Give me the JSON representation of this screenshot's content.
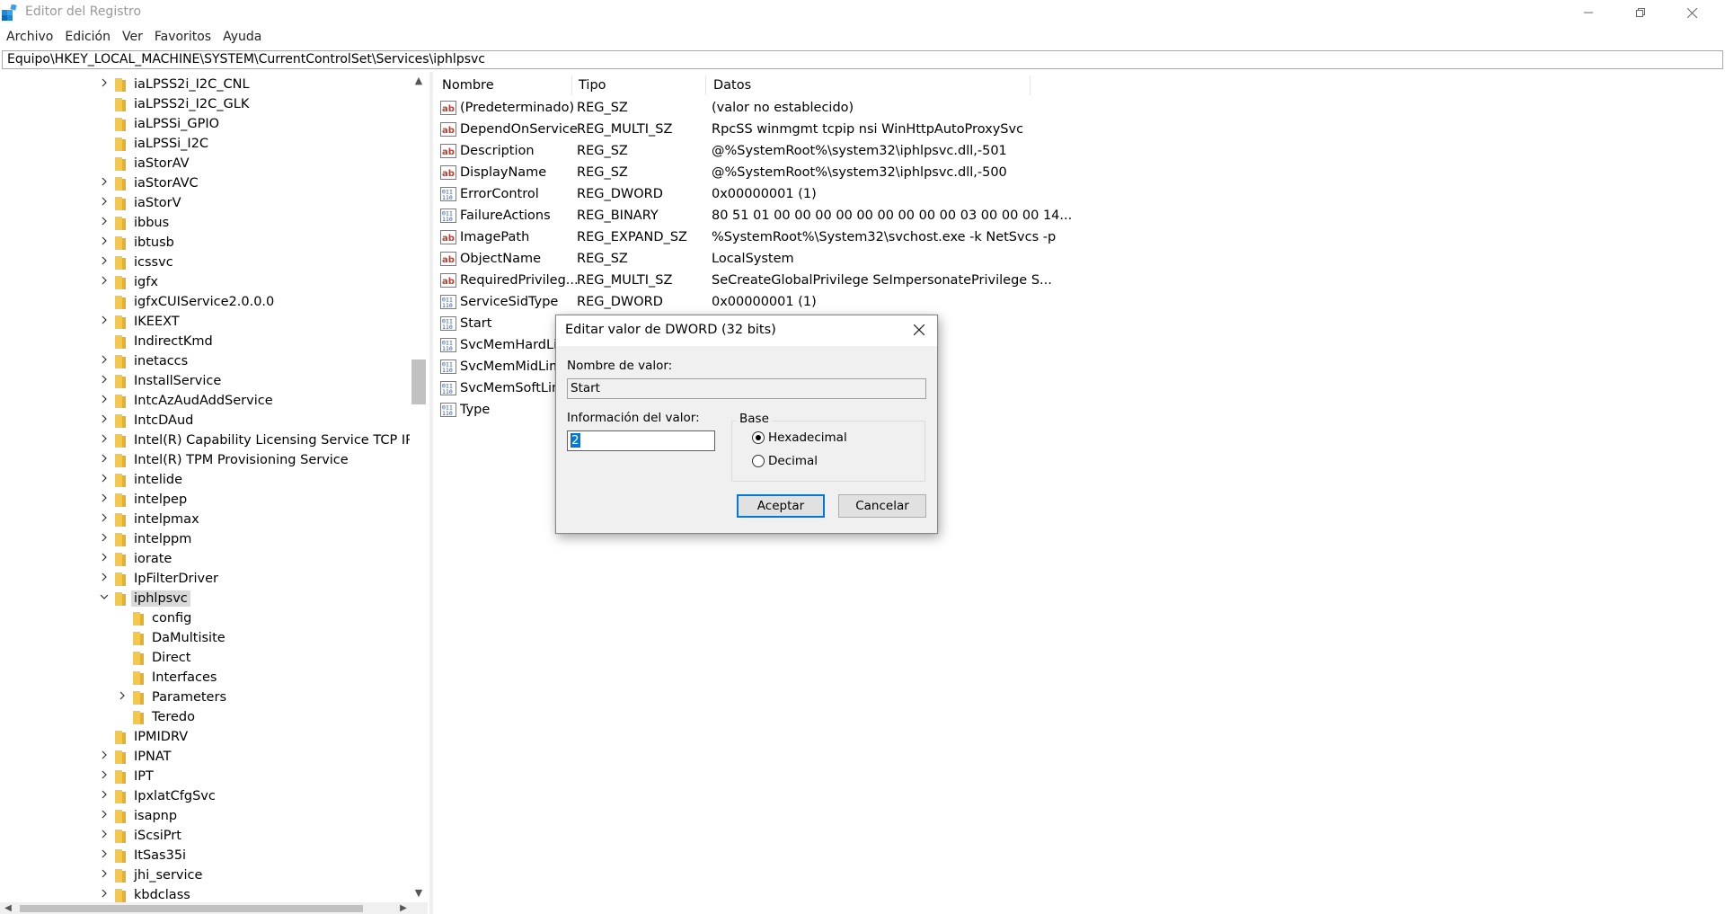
{
  "window": {
    "title": "Editor del Registro"
  },
  "menu": [
    "Archivo",
    "Edición",
    "Ver",
    "Favoritos",
    "Ayuda"
  ],
  "address": "Equipo\\HKEY_LOCAL_MACHINE\\SYSTEM\\CurrentControlSet\\Services\\iphlpsvc",
  "tree": [
    {
      "label": "iaLPSS2i_I2C_CNL",
      "expand": "closed",
      "level": 0
    },
    {
      "label": "iaLPSS2i_I2C_GLK",
      "expand": "none",
      "level": 0
    },
    {
      "label": "iaLPSSi_GPIO",
      "expand": "none",
      "level": 0
    },
    {
      "label": "iaLPSSi_I2C",
      "expand": "none",
      "level": 0
    },
    {
      "label": "iaStorAV",
      "expand": "none",
      "level": 0
    },
    {
      "label": "iaStorAVC",
      "expand": "closed",
      "level": 0
    },
    {
      "label": "iaStorV",
      "expand": "closed",
      "level": 0
    },
    {
      "label": "ibbus",
      "expand": "closed",
      "level": 0
    },
    {
      "label": "ibtusb",
      "expand": "closed",
      "level": 0
    },
    {
      "label": "icssvc",
      "expand": "closed",
      "level": 0
    },
    {
      "label": "igfx",
      "expand": "closed",
      "level": 0
    },
    {
      "label": "igfxCUIService2.0.0.0",
      "expand": "none",
      "level": 0
    },
    {
      "label": "IKEEXT",
      "expand": "closed",
      "level": 0
    },
    {
      "label": "IndirectKmd",
      "expand": "none",
      "level": 0
    },
    {
      "label": "inetaccs",
      "expand": "closed",
      "level": 0
    },
    {
      "label": "InstallService",
      "expand": "closed",
      "level": 0
    },
    {
      "label": "IntcAzAudAddService",
      "expand": "closed",
      "level": 0
    },
    {
      "label": "IntcDAud",
      "expand": "closed",
      "level": 0
    },
    {
      "label": "Intel(R) Capability Licensing Service TCP IP Inte",
      "expand": "closed",
      "level": 0
    },
    {
      "label": "Intel(R) TPM Provisioning Service",
      "expand": "closed",
      "level": 0
    },
    {
      "label": "intelide",
      "expand": "closed",
      "level": 0
    },
    {
      "label": "intelpep",
      "expand": "closed",
      "level": 0
    },
    {
      "label": "intelpmax",
      "expand": "closed",
      "level": 0
    },
    {
      "label": "intelppm",
      "expand": "closed",
      "level": 0
    },
    {
      "label": "iorate",
      "expand": "closed",
      "level": 0
    },
    {
      "label": "IpFilterDriver",
      "expand": "closed",
      "level": 0
    },
    {
      "label": "iphlpsvc",
      "expand": "open",
      "level": 0,
      "selected": true
    },
    {
      "label": "config",
      "expand": "none",
      "level": 1
    },
    {
      "label": "DaMultisite",
      "expand": "none",
      "level": 1
    },
    {
      "label": "Direct",
      "expand": "none",
      "level": 1
    },
    {
      "label": "Interfaces",
      "expand": "none",
      "level": 1
    },
    {
      "label": "Parameters",
      "expand": "closed",
      "level": 1
    },
    {
      "label": "Teredo",
      "expand": "none",
      "level": 1
    },
    {
      "label": "IPMIDRV",
      "expand": "none",
      "level": 0
    },
    {
      "label": "IPNAT",
      "expand": "closed",
      "level": 0
    },
    {
      "label": "IPT",
      "expand": "closed",
      "level": 0
    },
    {
      "label": "IpxlatCfgSvc",
      "expand": "closed",
      "level": 0
    },
    {
      "label": "isapnp",
      "expand": "closed",
      "level": 0
    },
    {
      "label": "iScsiPrt",
      "expand": "closed",
      "level": 0
    },
    {
      "label": "ItSas35i",
      "expand": "closed",
      "level": 0
    },
    {
      "label": "jhi_service",
      "expand": "closed",
      "level": 0
    },
    {
      "label": "kbdclass",
      "expand": "closed",
      "level": 0
    }
  ],
  "columns": {
    "name": "Nombre",
    "type": "Tipo",
    "data": "Datos"
  },
  "values": [
    {
      "icon": "string-value-icon",
      "name": "(Predeterminado)",
      "type": "REG_SZ",
      "data": "(valor no establecido)"
    },
    {
      "icon": "string-value-icon",
      "name": "DependOnService",
      "type": "REG_MULTI_SZ",
      "data": "RpcSS winmgmt tcpip nsi WinHttpAutoProxySvc"
    },
    {
      "icon": "string-value-icon",
      "name": "Description",
      "type": "REG_SZ",
      "data": "@%SystemRoot%\\system32\\iphlpsvc.dll,-501"
    },
    {
      "icon": "string-value-icon",
      "name": "DisplayName",
      "type": "REG_SZ",
      "data": "@%SystemRoot%\\system32\\iphlpsvc.dll,-500"
    },
    {
      "icon": "binary-value-icon",
      "name": "ErrorControl",
      "type": "REG_DWORD",
      "data": "0x00000001 (1)"
    },
    {
      "icon": "binary-value-icon",
      "name": "FailureActions",
      "type": "REG_BINARY",
      "data": "80 51 01 00 00 00 00 00 00 00 00 00 03 00 00 00 14..."
    },
    {
      "icon": "string-value-icon",
      "name": "ImagePath",
      "type": "REG_EXPAND_SZ",
      "data": "%SystemRoot%\\System32\\svchost.exe -k NetSvcs -p"
    },
    {
      "icon": "string-value-icon",
      "name": "ObjectName",
      "type": "REG_SZ",
      "data": "LocalSystem"
    },
    {
      "icon": "string-value-icon",
      "name": "RequiredPrivileg...",
      "type": "REG_MULTI_SZ",
      "data": "SeCreateGlobalPrivilege SeImpersonatePrivilege S..."
    },
    {
      "icon": "binary-value-icon",
      "name": "ServiceSidType",
      "type": "REG_DWORD",
      "data": "0x00000001 (1)"
    },
    {
      "icon": "binary-value-icon",
      "name": "Start",
      "type": "",
      "data": ""
    },
    {
      "icon": "binary-value-icon",
      "name": "SvcMemHardLim",
      "type": "",
      "data": ""
    },
    {
      "icon": "binary-value-icon",
      "name": "SvcMemMidLim",
      "type": "",
      "data": ""
    },
    {
      "icon": "binary-value-icon",
      "name": "SvcMemSoftLim",
      "type": "",
      "data": ""
    },
    {
      "icon": "binary-value-icon",
      "name": "Type",
      "type": "",
      "data": ""
    }
  ],
  "dialog": {
    "title": "Editar valor de DWORD (32 bits)",
    "value_name_label": "Nombre de valor:",
    "value_name": "Start",
    "value_data_label": "Información del valor:",
    "value_data": "2",
    "base_label": "Base",
    "hex_label": "Hexadecimal",
    "dec_label": "Decimal",
    "base_selected": "Hexadecimal",
    "ok_label": "Aceptar",
    "cancel_label": "Cancelar"
  },
  "colors": {
    "selection": "#0078d7",
    "folder": "#f4c84a",
    "tree_selected_bg": "#d9d9d9"
  }
}
